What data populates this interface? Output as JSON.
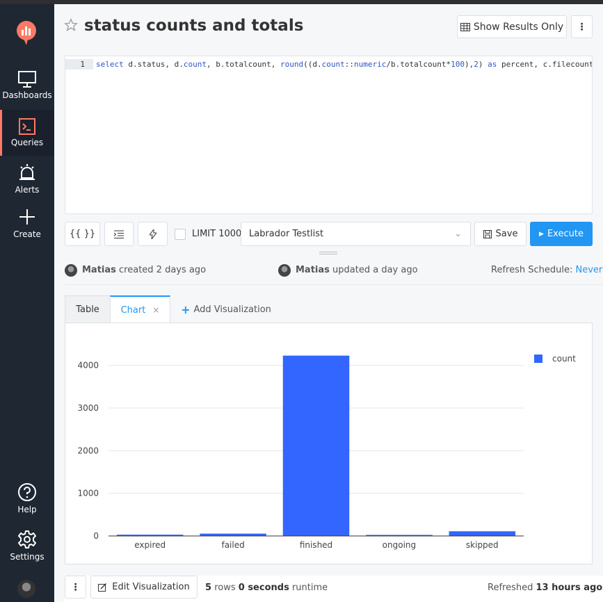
{
  "sidebar": {
    "items": [
      {
        "label": "Dashboards"
      },
      {
        "label": "Queries"
      },
      {
        "label": "Alerts"
      },
      {
        "label": "Create"
      }
    ],
    "bottom": [
      {
        "label": "Help"
      },
      {
        "label": "Settings"
      }
    ]
  },
  "header": {
    "title": "status counts and totals",
    "show_results_label": "Show Results Only"
  },
  "editor": {
    "line_number": "1",
    "code": "select d.status, d.count, b.totalcount, round((d.count::numeric/b.totalcount*100),2) as percent, c.filecount from (sele"
  },
  "toolbar": {
    "params_label": "{{ }}",
    "limit_label": "LIMIT 1000",
    "datasource": "Labrador Testlist",
    "save_label": "Save",
    "execute_label": "Execute"
  },
  "meta": {
    "created_user": "Matias",
    "created_text": "created 2 days ago",
    "updated_user": "Matias",
    "updated_text": "updated a day ago",
    "refresh_label": "Refresh Schedule:",
    "refresh_value": "Never"
  },
  "tabs": {
    "table": "Table",
    "chart": "Chart",
    "close": "×",
    "add": "Add Visualization"
  },
  "chart_data": {
    "type": "bar",
    "categories": [
      "expired",
      "failed",
      "finished",
      "ongoing",
      "skipped"
    ],
    "series": [
      {
        "name": "count",
        "values": [
          30,
          55,
          4230,
          25,
          110
        ],
        "color": "#3366ff"
      }
    ],
    "ylim": [
      0,
      4500
    ],
    "yticks": [
      0,
      1000,
      2000,
      3000,
      4000
    ],
    "grid": true,
    "legend": "top-right"
  },
  "footer": {
    "edit_label": "Edit Visualization",
    "rows_count": "5",
    "rows_label": "rows",
    "runtime_value": "0 seconds",
    "runtime_label": "runtime",
    "refreshed_label": "Refreshed",
    "refreshed_value": "13 hours ago"
  },
  "colors": {
    "accent": "#2196f3",
    "sidebar": "#1f2733",
    "active_marker": "#ff7964",
    "bar": "#3366ff"
  }
}
